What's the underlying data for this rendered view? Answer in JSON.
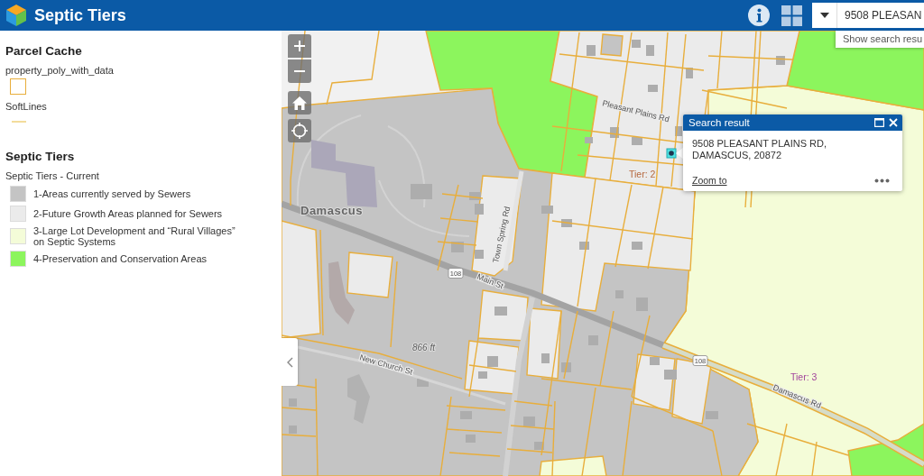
{
  "header": {
    "title": "Septic Tiers",
    "search": {
      "value": "9508 PLEASAN"
    },
    "suggestion": "Show search resu"
  },
  "parcel_cache": {
    "title": "Parcel Cache",
    "layers": [
      {
        "label": "property_poly_with_data",
        "kind": "outline",
        "color": "#e8ae3c"
      },
      {
        "label": "SoftLines",
        "kind": "line",
        "color": "#f3dc9c"
      }
    ]
  },
  "septic_tiers": {
    "title": "Septic Tiers",
    "layer_title": "Septic Tiers - Current",
    "classes": [
      {
        "label": "1-Areas currently served by Sewers",
        "color": "#c4c4c4"
      },
      {
        "label": "2-Future Growth Areas planned for Sewers",
        "color": "#ebebeb"
      },
      {
        "label": "3-Large Lot Development and “Rural Villages” on Septic Systems",
        "color": "#f4fcd8"
      },
      {
        "label": "4-Preservation and Conservation Areas",
        "color": "#8cf55d"
      }
    ]
  },
  "map": {
    "labels": [
      {
        "text": "Damascus",
        "kind": "place"
      },
      {
        "text": "Pleasant Plains Rd",
        "kind": "street"
      },
      {
        "text": "Town Spring Rd",
        "kind": "street"
      },
      {
        "text": "Main St",
        "kind": "street"
      },
      {
        "text": "New Church St",
        "kind": "street"
      },
      {
        "text": "866 ft",
        "kind": "elevation"
      },
      {
        "text": "Tier: 2",
        "kind": "tier",
        "color": "#b5683e"
      },
      {
        "text": "Tier: 3",
        "kind": "tier",
        "color": "#a2449c"
      },
      {
        "text": "Damascus Rd",
        "kind": "street"
      },
      {
        "text": "108",
        "kind": "route"
      },
      {
        "text": "108",
        "kind": "route"
      }
    ],
    "popup": {
      "title": "Search result",
      "address": "9508 PLEASANT PLAINS RD, DAMASCUS, 20872",
      "link": "Zoom to"
    }
  }
}
